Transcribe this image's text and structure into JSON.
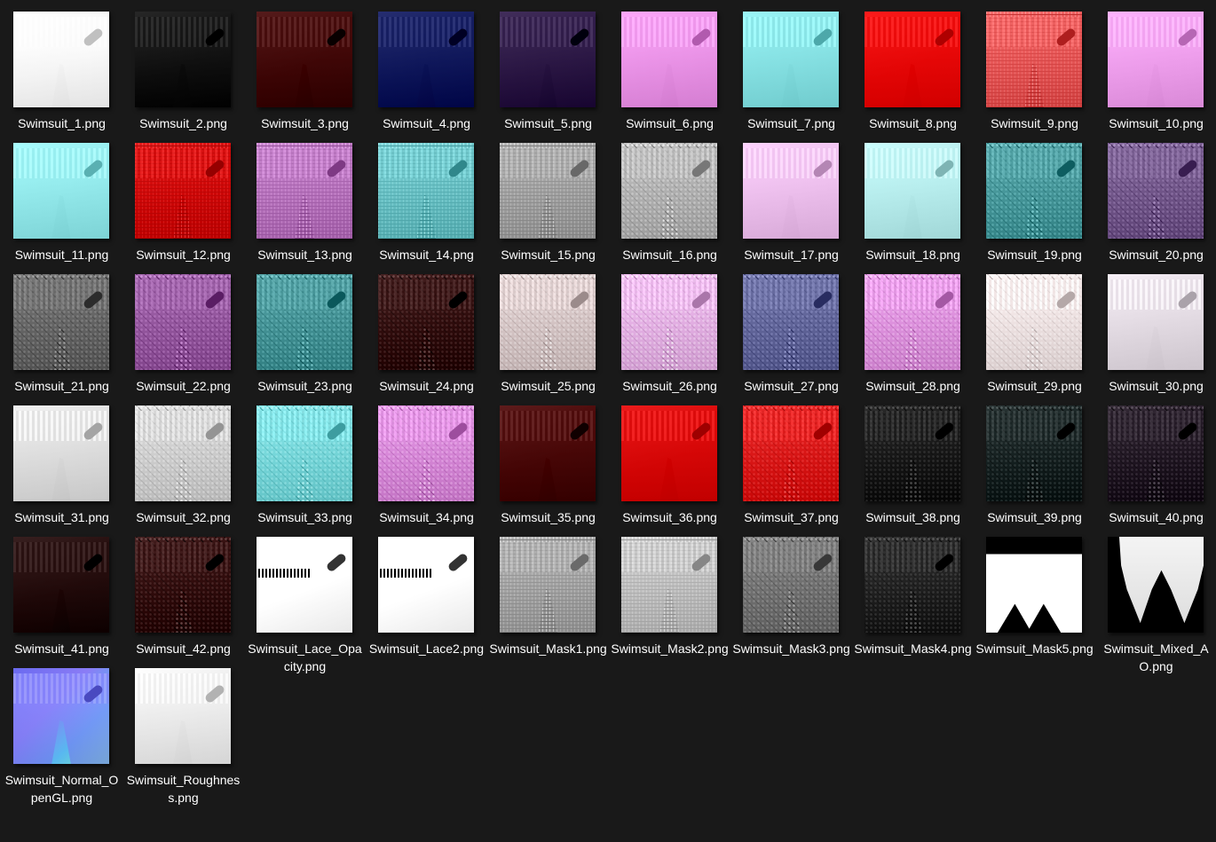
{
  "files": [
    {
      "name": "Swimsuit_1.png",
      "icon": "white-texture-thumbnail",
      "color": "#f2f2f2",
      "pattern": "none"
    },
    {
      "name": "Swimsuit_2.png",
      "icon": "black-texture-thumbnail",
      "color": "#0b0b0b",
      "pattern": "none"
    },
    {
      "name": "Swimsuit_3.png",
      "icon": "dark-red-texture-thumbnail",
      "color": "#3a0000",
      "pattern": "none"
    },
    {
      "name": "Swimsuit_4.png",
      "icon": "navy-texture-thumbnail",
      "color": "#0a1255",
      "pattern": "none"
    },
    {
      "name": "Swimsuit_5.png",
      "icon": "dark-purple-texture-thumbnail",
      "color": "#26123f",
      "pattern": "none"
    },
    {
      "name": "Swimsuit_6.png",
      "icon": "pink-texture-thumbnail",
      "color": "#e38ce0",
      "pattern": "none"
    },
    {
      "name": "Swimsuit_7.png",
      "icon": "cyan-texture-thumbnail",
      "color": "#7fdadc",
      "pattern": "none"
    },
    {
      "name": "Swimsuit_8.png",
      "icon": "red-texture-thumbnail",
      "color": "#e00000",
      "pattern": "none"
    },
    {
      "name": "Swimsuit_9.png",
      "icon": "red-white-pattern-thumbnail",
      "color": "#e05050",
      "pattern": "grid"
    },
    {
      "name": "Swimsuit_10.png",
      "icon": "pink-texture-thumbnail",
      "color": "#e898e6",
      "pattern": "none"
    },
    {
      "name": "Swimsuit_11.png",
      "icon": "cyan-texture-thumbnail",
      "color": "#8ce2e4",
      "pattern": "none"
    },
    {
      "name": "Swimsuit_12.png",
      "icon": "red-pattern-thumbnail",
      "color": "#c80000",
      "pattern": "grid"
    },
    {
      "name": "Swimsuit_13.png",
      "icon": "purple-pattern-thumbnail",
      "color": "#b06cb6",
      "pattern": "grid"
    },
    {
      "name": "Swimsuit_14.png",
      "icon": "teal-pattern-thumbnail",
      "color": "#62b9bd",
      "pattern": "grid"
    },
    {
      "name": "Swimsuit_15.png",
      "icon": "gray-pattern-thumbnail",
      "color": "#9a9a9a",
      "pattern": "grid"
    },
    {
      "name": "Swimsuit_16.png",
      "icon": "gray-pattern-thumbnail",
      "color": "#a9a9a9",
      "pattern": "dots"
    },
    {
      "name": "Swimsuit_17.png",
      "icon": "light-pink-texture-thumbnail",
      "color": "#e6b8e6",
      "pattern": "none"
    },
    {
      "name": "Swimsuit_18.png",
      "icon": "light-cyan-texture-thumbnail",
      "color": "#b0e6e6",
      "pattern": "none"
    },
    {
      "name": "Swimsuit_19.png",
      "icon": "teal-pattern-thumbnail",
      "color": "#3f8f92",
      "pattern": "dots"
    },
    {
      "name": "Swimsuit_20.png",
      "icon": "purple-pattern-thumbnail",
      "color": "#6a4f82",
      "pattern": "dots"
    },
    {
      "name": "Swimsuit_21.png",
      "icon": "gray-pattern-thumbnail",
      "color": "#5e5e5e",
      "pattern": "dots"
    },
    {
      "name": "Swimsuit_22.png",
      "icon": "purple-pattern-thumbnail",
      "color": "#8c4f96",
      "pattern": "dots"
    },
    {
      "name": "Swimsuit_23.png",
      "icon": "teal-pattern-thumbnail",
      "color": "#3c8a8d",
      "pattern": "dots"
    },
    {
      "name": "Swimsuit_24.png",
      "icon": "dark-red-pattern-thumbnail",
      "color": "#2a0606",
      "pattern": "dots"
    },
    {
      "name": "Swimsuit_25.png",
      "icon": "light-gray-pattern-thumbnail",
      "color": "#cdbdbd",
      "pattern": "dots"
    },
    {
      "name": "Swimsuit_26.png",
      "icon": "light-pink-pattern-thumbnail",
      "color": "#dca8dc",
      "pattern": "dots"
    },
    {
      "name": "Swimsuit_27.png",
      "icon": "navy-pattern-thumbnail",
      "color": "#5a5e92",
      "pattern": "dots"
    },
    {
      "name": "Swimsuit_28.png",
      "icon": "pink-pattern-thumbnail",
      "color": "#d68ad6",
      "pattern": "dots"
    },
    {
      "name": "Swimsuit_29.png",
      "icon": "light-pattern-thumbnail",
      "color": "#e6dada",
      "pattern": "dots"
    },
    {
      "name": "Swimsuit_30.png",
      "icon": "light-pattern-thumbnail",
      "color": "#dcd4dc",
      "pattern": "none"
    },
    {
      "name": "Swimsuit_31.png",
      "icon": "light-gray-texture-thumbnail",
      "color": "#d6d6d6",
      "pattern": "none"
    },
    {
      "name": "Swimsuit_32.png",
      "icon": "light-gray-pattern-thumbnail",
      "color": "#c6c6c6",
      "pattern": "dots"
    },
    {
      "name": "Swimsuit_33.png",
      "icon": "cyan-pattern-thumbnail",
      "color": "#6fcfd2",
      "pattern": "dots"
    },
    {
      "name": "Swimsuit_34.png",
      "icon": "pink-pattern-thumbnail",
      "color": "#cf80d0",
      "pattern": "dots"
    },
    {
      "name": "Swimsuit_35.png",
      "icon": "dark-red-texture-thumbnail",
      "color": "#420000",
      "pattern": "none"
    },
    {
      "name": "Swimsuit_36.png",
      "icon": "red-texture-thumbnail",
      "color": "#d00000",
      "pattern": "none"
    },
    {
      "name": "Swimsuit_37.png",
      "icon": "red-pattern-thumbnail",
      "color": "#d21010",
      "pattern": "dots"
    },
    {
      "name": "Swimsuit_38.png",
      "icon": "black-pattern-thumbnail",
      "color": "#111111",
      "pattern": "dots"
    },
    {
      "name": "Swimsuit_39.png",
      "icon": "black-teal-pattern-thumbnail",
      "color": "#0f1a1a",
      "pattern": "dots"
    },
    {
      "name": "Swimsuit_40.png",
      "icon": "black-purple-pattern-thumbnail",
      "color": "#1a101c",
      "pattern": "dots"
    },
    {
      "name": "Swimsuit_41.png",
      "icon": "very-dark-red-texture-thumbnail",
      "color": "#1c0404",
      "pattern": "none"
    },
    {
      "name": "Swimsuit_42.png",
      "icon": "dark-red-pattern-thumbnail",
      "color": "#2a0505",
      "pattern": "dots"
    },
    {
      "name": "Swimsuit_Lace_Opacity.png",
      "icon": "white-mask-thumbnail",
      "color": "#ffffff",
      "pattern": "lace"
    },
    {
      "name": "Swimsuit_Lace2.png",
      "icon": "white-mask-thumbnail",
      "color": "#ffffff",
      "pattern": "lace"
    },
    {
      "name": "Swimsuit_Mask1.png",
      "icon": "bw-mask-thumbnail",
      "color": "#9c9c9c",
      "pattern": "grid"
    },
    {
      "name": "Swimsuit_Mask2.png",
      "icon": "bw-mask-thumbnail",
      "color": "#b8b8b8",
      "pattern": "grid"
    },
    {
      "name": "Swimsuit_Mask3.png",
      "icon": "bw-mask-thumbnail",
      "color": "#6a6a6a",
      "pattern": "dots"
    },
    {
      "name": "Swimsuit_Mask4.png",
      "icon": "bw-mask-thumbnail",
      "color": "#1a1a1a",
      "pattern": "dots"
    },
    {
      "name": "Swimsuit_Mask5.png",
      "icon": "bw-mask-thumbnail",
      "color": "#000000",
      "pattern": "mask5"
    },
    {
      "name": "Swimsuit_Mixed_AO.png",
      "icon": "ao-map-thumbnail",
      "color": "#000000",
      "pattern": "ao"
    },
    {
      "name": "Swimsuit_Normal_OpenGL.png",
      "icon": "normal-map-thumbnail",
      "color": "#7c7cf2",
      "pattern": "normal"
    },
    {
      "name": "Swimsuit_Roughness.png",
      "icon": "roughness-map-thumbnail",
      "color": "#e4e4e4",
      "pattern": "none"
    }
  ]
}
